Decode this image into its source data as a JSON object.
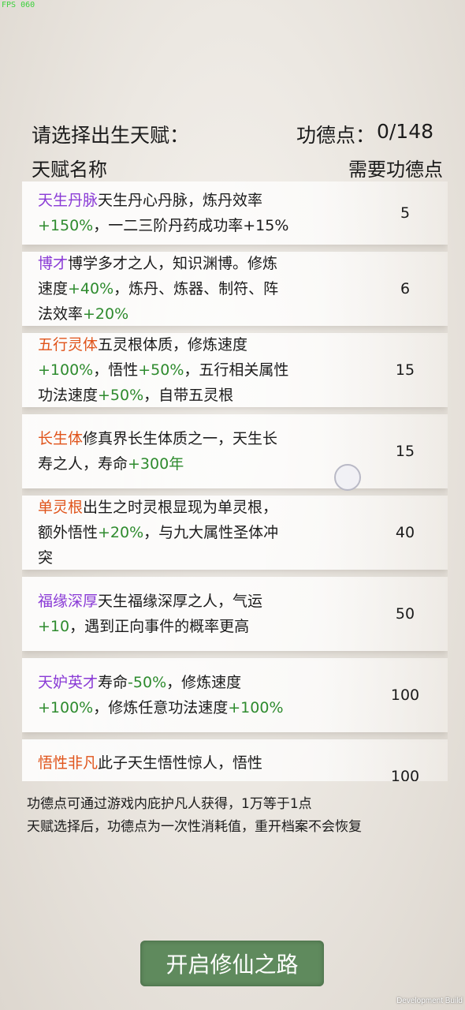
{
  "debug": {
    "fps": "FPS 060",
    "build": "Development Build"
  },
  "header": {
    "title": "请选择出生天赋：",
    "points_label": "功德点：",
    "points_value": "0/148",
    "col_name": "天赋名称",
    "col_cost": "需要功德点"
  },
  "talents": [
    {
      "name": "天生丹脉",
      "name_color": "#8a3bd6",
      "cost": "5",
      "line1": "天生丹心丹脉，炼丹效率",
      "line2_green": "+150%",
      "line2_rest": "，一二三阶丹药成功率+15%"
    },
    {
      "name": "博才",
      "name_color": "#8a3bd6",
      "cost": "6",
      "line1": "博学多才之人，知识渊博。修炼",
      "line2_a": "速度",
      "line2_green": "+40%",
      "line2_rest": "，炼丹、炼器、制符、阵",
      "line3_a": "法效率",
      "line3_green": "+20%"
    },
    {
      "name": "五行灵体",
      "name_color": "#e0541b",
      "cost": "15",
      "line1": "五灵根体质，修炼速度",
      "line2_green1": "+100%",
      "line2_mid": "，悟性",
      "line2_green2": "+50%",
      "line2_rest": "，五行相关属性",
      "line3_a": "功法速度",
      "line3_green": "+50%",
      "line3_rest": "，自带五灵根"
    },
    {
      "name": "长生体",
      "name_color": "#e0541b",
      "cost": "15",
      "line1": "修真界长生体质之一，天生长",
      "line2_a": "寿之人，寿命",
      "line2_green": "+300年"
    },
    {
      "name": "单灵根",
      "name_color": "#e0541b",
      "cost": "40",
      "line1": "出生之时灵根显现为单灵根，",
      "line2_a": "额外悟性",
      "line2_green": "+20%",
      "line2_rest": "，与九大属性圣体冲",
      "line3_a": "突"
    },
    {
      "name": "福缘深厚",
      "name_color": "#8a3bd6",
      "cost": "50",
      "line1": "天生福缘深厚之人，气运",
      "line2_green": "+10",
      "line2_rest": "，遇到正向事件的概率更高"
    },
    {
      "name": "天妒英才",
      "name_color": "#8a3bd6",
      "cost": "100",
      "line1_a": "寿命",
      "line1_green": "-50%",
      "line1_rest": "，修炼速度",
      "line2_green1": "+100%",
      "line2_mid": "，修炼任意功法速度",
      "line2_green2": "+100%"
    },
    {
      "name": "悟性非凡",
      "name_color": "#e0541b",
      "cost": "100",
      "line1": "此子天生悟性惊人，悟性"
    }
  ],
  "notes": {
    "line1": "功德点可通过游戏内庇护凡人获得，1万等于1点",
    "line2": "天赋选择后，功德点为一次性消耗值，重开档案不会恢复"
  },
  "start_button": "开启修仙之路",
  "colors": {
    "button": "#5f8a5d",
    "green_text": "#2e8b2e",
    "purple": "#8a3bd6",
    "orange": "#e0541b"
  }
}
